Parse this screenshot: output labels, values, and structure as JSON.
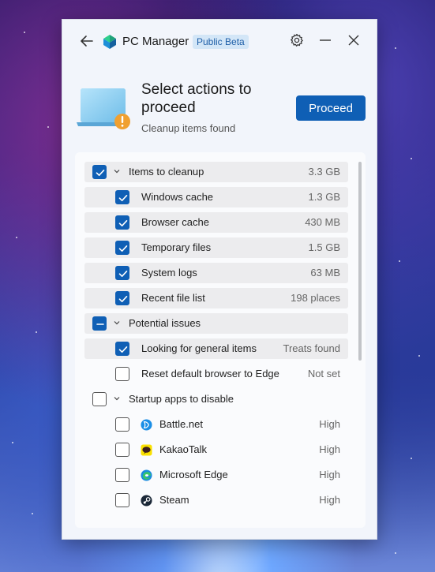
{
  "app": {
    "title": "PC Manager",
    "badge": "Public Beta",
    "icons": [
      "back-arrow-icon",
      "settings-gear-icon",
      "minimize-icon",
      "close-icon"
    ]
  },
  "header": {
    "headline": "Select actions to proceed",
    "subline": "Cleanup items found",
    "proceed_label": "Proceed",
    "accent_color": "#0f5fb5",
    "warning_color": "#f0a030"
  },
  "groups": {
    "cleanup": {
      "label": "Items to cleanup",
      "value": "3.3 GB",
      "state": "checked",
      "items": [
        {
          "label": "Windows cache",
          "value": "1.3 GB",
          "checked": true
        },
        {
          "label": "Browser cache",
          "value": "430 MB",
          "checked": true
        },
        {
          "label": "Temporary files",
          "value": "1.5 GB",
          "checked": true
        },
        {
          "label": "System logs",
          "value": "63 MB",
          "checked": true
        },
        {
          "label": "Recent file list",
          "value": "198 places",
          "checked": true
        }
      ]
    },
    "issues": {
      "label": "Potential issues",
      "value": "",
      "state": "partial",
      "items": [
        {
          "label": "Looking for general items",
          "value": "Treats found",
          "checked": true
        },
        {
          "label": "Reset default browser to Edge",
          "value": "Not set",
          "checked": false
        }
      ]
    },
    "startup": {
      "label": "Startup apps to disable",
      "value": "",
      "state": "unchecked",
      "items": [
        {
          "label": "Battle.net",
          "value": "High",
          "checked": false,
          "icon": "battlenet-icon"
        },
        {
          "label": "KakaoTalk",
          "value": "High",
          "checked": false,
          "icon": "kakaotalk-icon"
        },
        {
          "label": "Microsoft Edge",
          "value": "High",
          "checked": false,
          "icon": "edge-icon"
        },
        {
          "label": "Steam",
          "value": "High",
          "checked": false,
          "icon": "steam-icon"
        }
      ]
    }
  }
}
